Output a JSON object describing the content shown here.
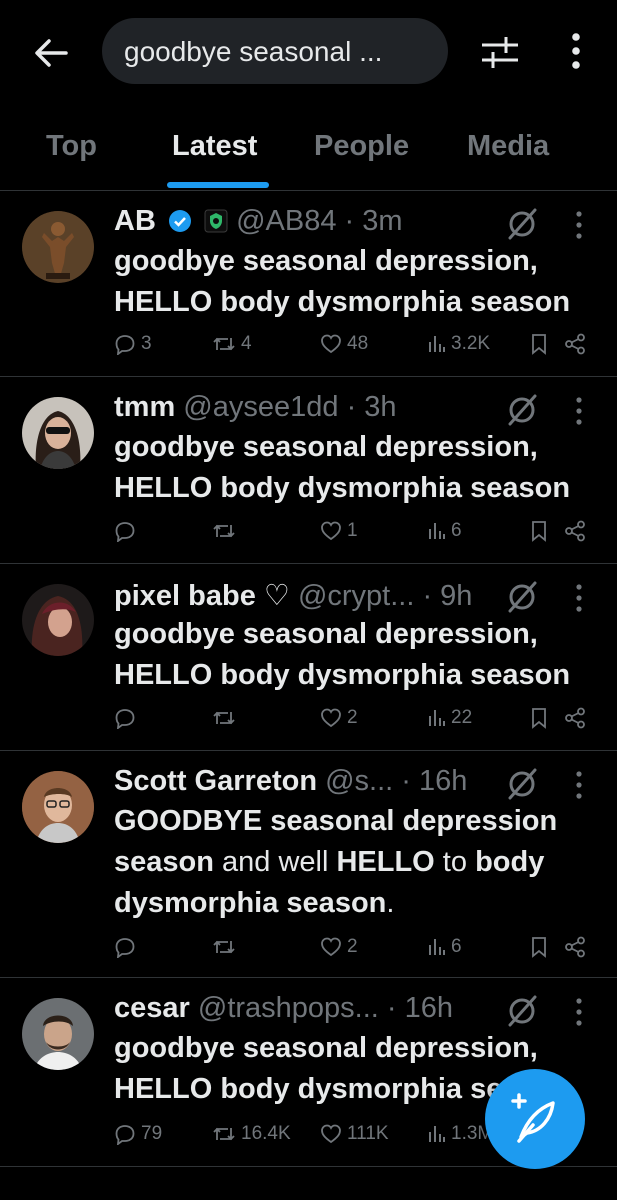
{
  "search": {
    "query": "goodbye seasonal ..."
  },
  "tabs": [
    {
      "label": "Top"
    },
    {
      "label": "Latest"
    },
    {
      "label": "People"
    },
    {
      "label": "Media"
    }
  ],
  "posts": [
    {
      "name": "AB",
      "handle": "@AB84",
      "time": "· 3m",
      "verified": true,
      "affiliate_badge": true,
      "body_lines": [
        "goodbye seasonal depression,",
        "HELLO body dysmorphia season"
      ],
      "replies": "3",
      "reposts": "4",
      "likes": "48",
      "views": "3.2K"
    },
    {
      "name": "tmm",
      "handle": "@aysee1dd",
      "time": "· 3h",
      "body_lines": [
        "goodbye seasonal depression,",
        "HELLO body dysmorphia season"
      ],
      "replies": "",
      "reposts": "",
      "likes": "1",
      "views": "6"
    },
    {
      "name": "pixel babe ♡",
      "handle": "@crypt...",
      "time": "· 9h",
      "body_lines": [
        "goodbye seasonal depression,",
        "HELLO body dysmorphia season"
      ],
      "replies": "",
      "reposts": "",
      "likes": "2",
      "views": "22"
    },
    {
      "name": "Scott Garreton",
      "handle": "@s...",
      "time": "· 16h",
      "body_rich": {
        "l1_bold": "GOODBYE seasonal depression",
        "l2_bold1": "season",
        "l2_normal": " and well ",
        "l2_bold2": "HELLO",
        "l2_normal2": " to ",
        "l2_bold3": "body",
        "l3_bold": "dysmorphia season",
        "l3_normal": "."
      },
      "replies": "",
      "reposts": "",
      "likes": "2",
      "views": "6"
    },
    {
      "name": "cesar",
      "handle": "@trashpops...",
      "time": "· 16h",
      "body_lines": [
        "goodbye seasonal depression,",
        "HELLO body dysmorphia season"
      ],
      "replies": "79",
      "reposts": "16.4K",
      "likes": "111K",
      "views": "1.3M"
    }
  ],
  "colors": {
    "accent": "#1d9bf0",
    "muted": "#71767b",
    "text": "#e7e9ea",
    "background": "#000000"
  }
}
